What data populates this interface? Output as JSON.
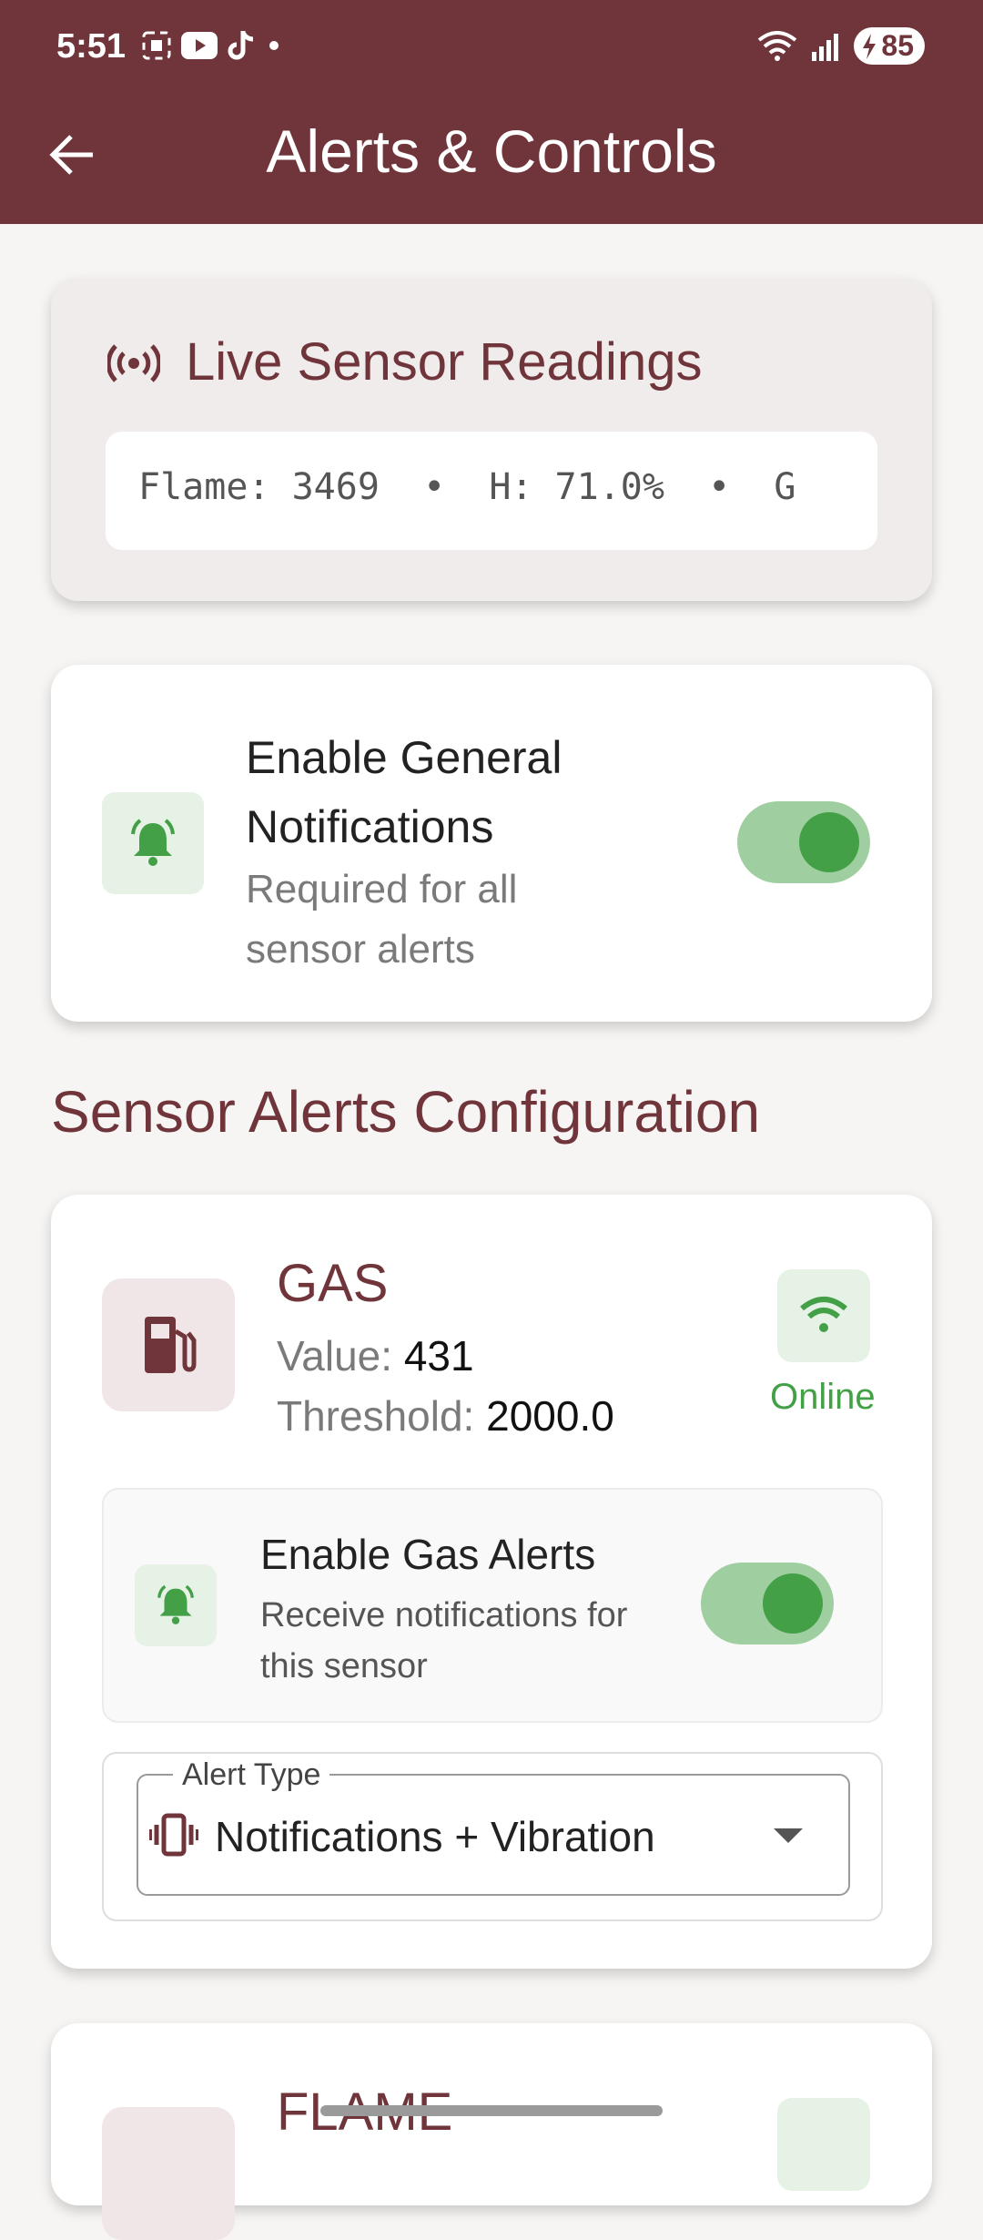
{
  "status_bar": {
    "time": "5:51",
    "battery": "85",
    "icons_left": [
      "screenshot-icon",
      "youtube-icon",
      "tiktok-icon",
      "dot-icon"
    ],
    "icons_right": [
      "wifi-icon",
      "signal-icon",
      "battery-icon"
    ]
  },
  "app_bar": {
    "title": "Alerts & Controls",
    "back_icon": "arrow-back-icon"
  },
  "live_card": {
    "title": "Live Sensor Readings",
    "readings": "Flame: 3469  •  H: 71.0%  •  G"
  },
  "general_notifications": {
    "title_line1": "Enable General",
    "title_line2": "Notifications",
    "subtitle": "Required for all sensor alerts",
    "enabled": true
  },
  "section": {
    "title": "Sensor Alerts Configuration"
  },
  "sensors": [
    {
      "name": "GAS",
      "value_label": "Value:",
      "value": "431",
      "threshold_label": "Threshold:",
      "threshold": "2000.0",
      "status": "Online",
      "enable_title": "Enable Gas Alerts",
      "enable_desc": "Receive notifications for this sensor",
      "enabled": true,
      "alert_type_label": "Alert Type",
      "alert_type_value": "Notifications + Vibration"
    },
    {
      "name": "FLAME"
    }
  ],
  "colors": {
    "primary": "#6f353b",
    "accent_green": "#43a047",
    "toggle_track": "#9fcfa0",
    "background": "#f7f5f3"
  }
}
